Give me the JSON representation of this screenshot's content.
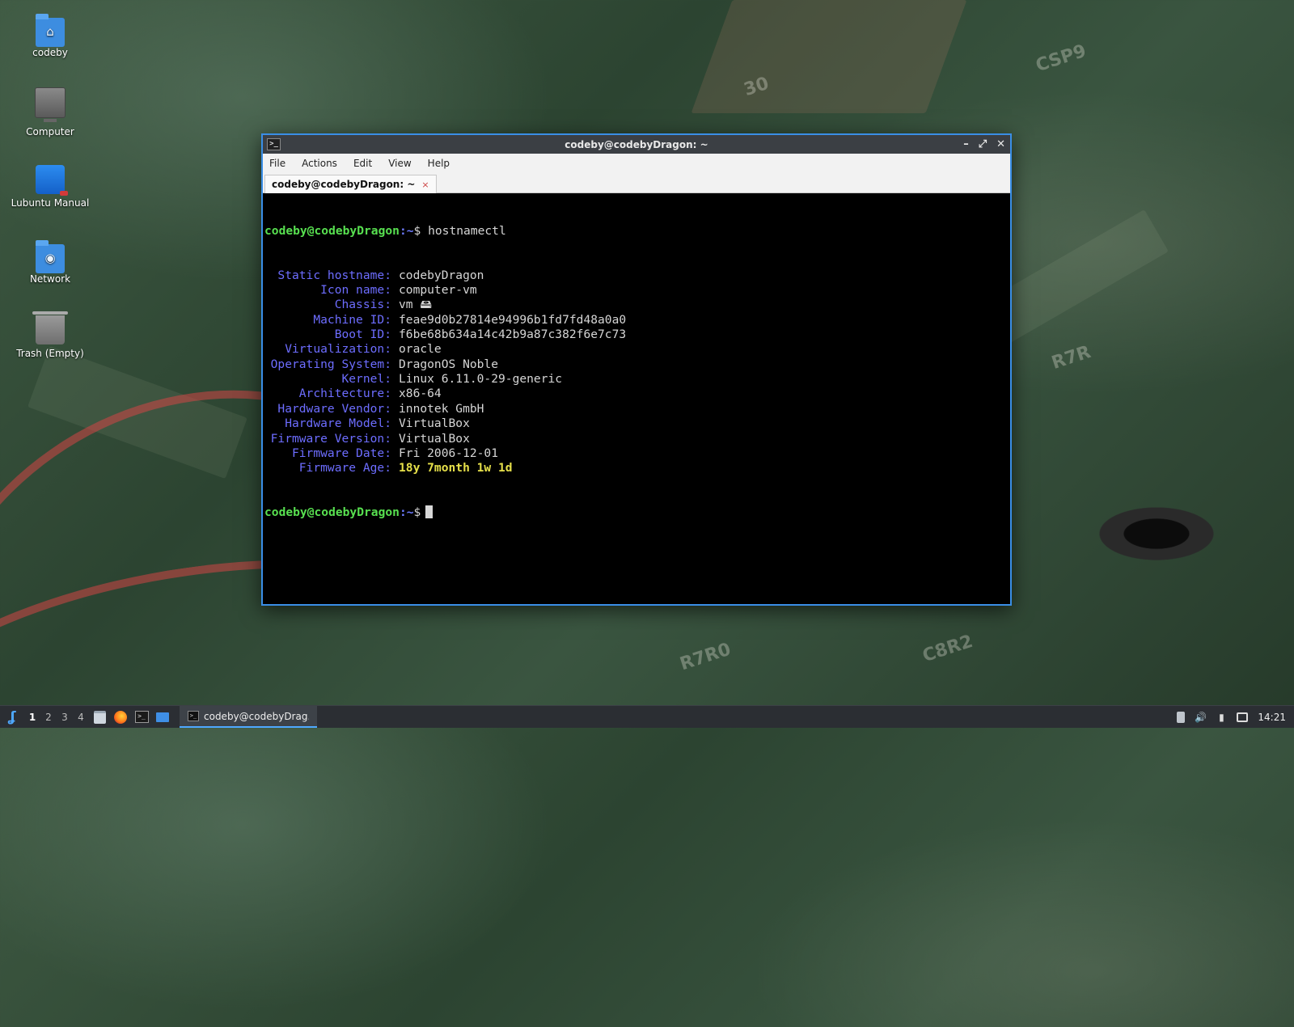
{
  "desktop": {
    "icons": [
      {
        "label": "codeby",
        "icon": "home-folder-icon"
      },
      {
        "label": "Computer",
        "icon": "computer-icon"
      },
      {
        "label": "Lubuntu Manual",
        "icon": "manual-icon"
      },
      {
        "label": "Network",
        "icon": "network-folder-icon"
      },
      {
        "label": "Trash (Empty)",
        "icon": "trash-icon"
      }
    ]
  },
  "window": {
    "title": "codeby@codebyDragon: ~",
    "controls": {
      "minimize": "–",
      "maximize": "⤢",
      "close": "✕"
    },
    "menu": [
      "File",
      "Actions",
      "Edit",
      "View",
      "Help"
    ],
    "tab": {
      "label": "codeby@codebyDragon: ~",
      "close": "×"
    }
  },
  "terminal": {
    "prompt_user": "codeby@codebyDragon",
    "prompt_path": ":~",
    "prompt_symbol": "$",
    "command": "hostnamectl",
    "rows": [
      {
        "key": "Static hostname:",
        "value": "codebyDragon"
      },
      {
        "key": "Icon name:",
        "value": "computer-vm"
      },
      {
        "key": "Chassis:",
        "value": "vm 🖴"
      },
      {
        "key": "Machine ID:",
        "value": "feae9d0b27814e94996b1fd7fd48a0a0"
      },
      {
        "key": "Boot ID:",
        "value": "f6be68b634a14c42b9a87c382f6e7c73"
      },
      {
        "key": "Virtualization:",
        "value": "oracle"
      },
      {
        "key": "Operating System:",
        "value": "DragonOS Noble"
      },
      {
        "key": "Kernel:",
        "value": "Linux 6.11.0-29-generic"
      },
      {
        "key": "Architecture:",
        "value": "x86-64"
      },
      {
        "key": "Hardware Vendor:",
        "value": "innotek GmbH"
      },
      {
        "key": "Hardware Model:",
        "value": "VirtualBox"
      },
      {
        "key": "Firmware Version:",
        "value": "VirtualBox"
      },
      {
        "key": "Firmware Date:",
        "value": "Fri 2006-12-01"
      },
      {
        "key": "Firmware Age:",
        "value": "18y 7month 1w 1d"
      }
    ]
  },
  "taskbar": {
    "workspaces": [
      "1",
      "2",
      "3",
      "4"
    ],
    "active_workspace": "1",
    "task_label": "codeby@codebyDrag...",
    "clock": "14:21"
  },
  "colors": {
    "accent": "#3a8ee6",
    "prompt_user": "#58e050",
    "prompt_path": "#6d7bff",
    "key": "#6d6dff",
    "highlight": "#e6e04a"
  }
}
